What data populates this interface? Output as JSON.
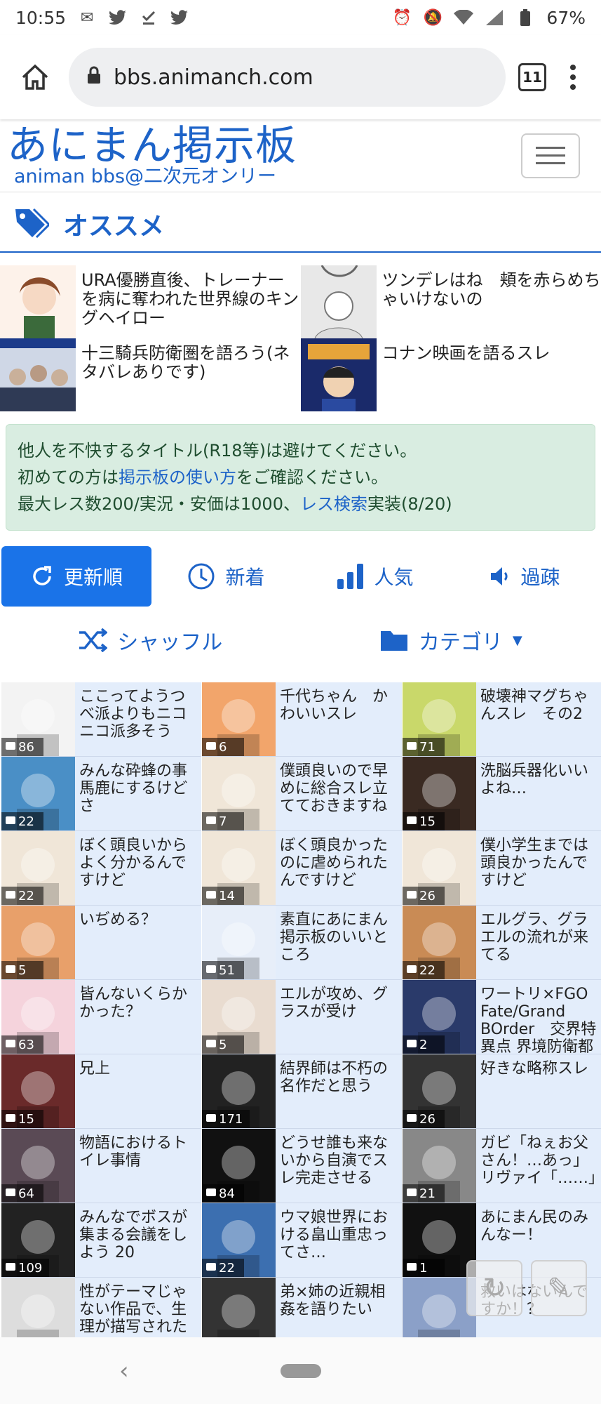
{
  "statusbar": {
    "time": "10:55",
    "battery": "67%"
  },
  "browser": {
    "url": "bbs.animanch.com",
    "tab_count": "11"
  },
  "site": {
    "logo_main": "あにまん掲示板",
    "logo_sub": "animan bbs@二次元オンリー"
  },
  "recommend": {
    "title": "オススメ",
    "items": [
      {
        "text": "URA優勝直後、トレーナーを病に奪われた世界線のキングヘイロー"
      },
      {
        "text": "ツンデレはね　頬を赤らめちゃいけないの"
      },
      {
        "text": "十三騎兵防衛圏を語ろう(ネタバレありです)"
      },
      {
        "text": "コナン映画を語るスレ"
      }
    ]
  },
  "notice": {
    "line1": "他人を不快するタイトル(R18等)は避けてください。",
    "line2_pre": "初めての方は",
    "line2_link": "掲示板の使い方",
    "line2_post": "をご確認ください。",
    "line3_pre": "最大レス数200/実況・安価は1000、",
    "line3_link": "レス検索",
    "line3_post": "実装(8/20)"
  },
  "sort": {
    "update": "更新順",
    "new": "新着",
    "popular": "人気",
    "sparse": "過疎"
  },
  "tools": {
    "shuffle": "シャッフル",
    "category": "カテゴリ"
  },
  "threads": [
    {
      "title": "ここってようつべ派よりもニコニコ派多そう",
      "count": "86",
      "color": "#f3f3f3"
    },
    {
      "title": "千代ちゃん　かわいいスレ",
      "count": "6",
      "color": "#f2a56b"
    },
    {
      "title": "破壊神マグちゃんスレ　その2",
      "count": "71",
      "color": "#c9d86a"
    },
    {
      "title": "みんな砕蜂の事馬鹿にするけどさ",
      "count": "22",
      "color": "#4a8fc6"
    },
    {
      "title": "僕頭良いので早めに総合スレ立てておきますね",
      "count": "7",
      "color": "#f0e6d8"
    },
    {
      "title": "洗脳兵器化いいよね…",
      "count": "15",
      "color": "#3a2a22"
    },
    {
      "title": "ぼく頭良いからよく分かるんですけど",
      "count": "22",
      "color": "#f0e6d8"
    },
    {
      "title": "ぼく頭良かったのに虐められたんですけど",
      "count": "14",
      "color": "#f0e6d8"
    },
    {
      "title": "僕小学生までは頭良かったんですけど",
      "count": "26",
      "color": "#f0e6d8"
    },
    {
      "title": "いぢめる？",
      "count": "5",
      "color": "#e8a06a"
    },
    {
      "title": "素直にあにまん掲示板のいいところ",
      "count": "51",
      "color": "#e7eef9"
    },
    {
      "title": "エルグラ、グラエルの流れが来てる",
      "count": "22",
      "color": "#c98b55"
    },
    {
      "title": "皆んないくらかかった？",
      "count": "63",
      "color": "#f5d3dc"
    },
    {
      "title": "エルが攻め、グラスが受け",
      "count": "5",
      "color": "#e9dcd0"
    },
    {
      "title": "ワートリ×FGO Fate/Grand BOrder　交界特異点 界境防衛都市ミ",
      "count": "2",
      "color": "#2a3a6a"
    },
    {
      "title": "兄上",
      "count": "15",
      "color": "#6a2a2a"
    },
    {
      "title": "結界師は不朽の名作だと思う",
      "count": "171",
      "color": "#222"
    },
    {
      "title": "好きな略称スレ",
      "count": "26",
      "color": "#333"
    },
    {
      "title": "物語におけるトイレ事情",
      "count": "64",
      "color": "#5a4a55"
    },
    {
      "title": "どうせ誰も来ないから自演でスレ完走させる",
      "count": "84",
      "color": "#111"
    },
    {
      "title": "ガビ「ねぇお父さん！…あっ」リヴァイ「……」",
      "count": "21",
      "color": "#888"
    },
    {
      "title": "みんなでボスが集まる会議をしよう 20",
      "count": "109",
      "color": "#222"
    },
    {
      "title": "ウマ娘世界における畠山重忠ってさ…",
      "count": "22",
      "color": "#3c6fb0"
    },
    {
      "title": "あにまん民のみんなー！",
      "count": "1",
      "color": "#111"
    },
    {
      "title": "性がテーマじゃない作品で、生理が描写された",
      "count": "",
      "color": "#ddd"
    },
    {
      "title": "弟×姉の近親相姦を語りたい",
      "count": "",
      "color": "#333"
    },
    {
      "title": "救いはないんですか！？",
      "count": "",
      "color": "#8ba0c8"
    }
  ]
}
